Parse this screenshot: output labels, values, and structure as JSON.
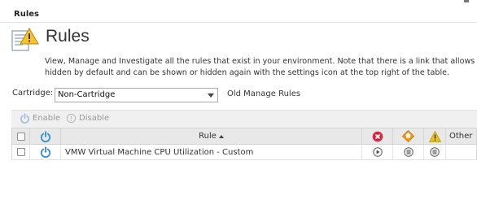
{
  "breadcrumb": "Rules",
  "page_title": "Rules",
  "description": {
    "line1": "View, Manage and Investigate all the rules that exist in your environment. Note that there is a link that allows a",
    "line2": "hidden by default and can be shown or hidden again with the settings icon at the top right of the table."
  },
  "cartridge": {
    "label": "Cartridge:",
    "selected": "Non-Cartridge"
  },
  "old_link": "Old Manage Rules",
  "toolbar": {
    "enable": "Enable",
    "disable": "Disable"
  },
  "grid": {
    "columns": {
      "rule": "Rule",
      "other": "Other"
    },
    "rows": [
      {
        "rule": "VMW Virtual Machine CPU Utilization - Custom"
      }
    ]
  },
  "colors": {
    "power_blue": "#2f8fdb",
    "fatal_red": "#d7263d",
    "critical_orange": "#f39c12",
    "warning_yellow": "#f1c40f",
    "toolbar_bg": "#f0f0f0",
    "header_bg": "#e8e8e8"
  },
  "icons": [
    "rules-warning-icon",
    "power-icon",
    "fatal-icon",
    "critical-icon",
    "warning-icon",
    "play-icon",
    "list-icon"
  ]
}
